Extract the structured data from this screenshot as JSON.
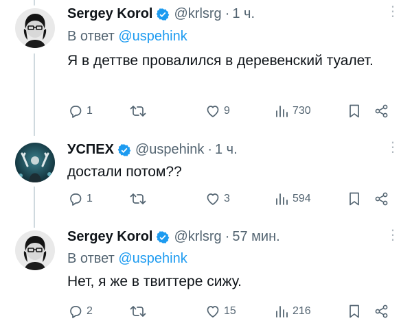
{
  "tweets": [
    {
      "name": "Sergey Korol",
      "handle": "@krlsrg",
      "dot": "·",
      "time": "1 ч.",
      "reply_prefix": "В ответ",
      "reply_mention": "@uspehink",
      "text": "Я в деттве провалился в деревенский туалет.",
      "replies": "1",
      "retweets": "",
      "likes": "9",
      "views": "730",
      "avatar_icon": "person-glasses-avatar"
    },
    {
      "name": "УСПЕХ",
      "handle": "@uspehink",
      "dot": "·",
      "time": "1 ч.",
      "text": "достали потом??",
      "replies": "1",
      "retweets": "",
      "likes": "3",
      "views": "594",
      "avatar_icon": "concert-photo-avatar"
    },
    {
      "name": "Sergey Korol",
      "handle": "@krlsrg",
      "dot": "·",
      "time": "57 мин.",
      "reply_prefix": "В ответ",
      "reply_mention": "@uspehink",
      "text": "Нет, я же в твиттере сижу.",
      "replies": "2",
      "retweets": "",
      "likes": "15",
      "views": "216",
      "avatar_icon": "person-glasses-avatar"
    }
  ],
  "colors": {
    "accent": "#1d9bf0",
    "muted": "#536471",
    "verified": "#1d9bf0",
    "thread_line": "#cfd9de"
  }
}
